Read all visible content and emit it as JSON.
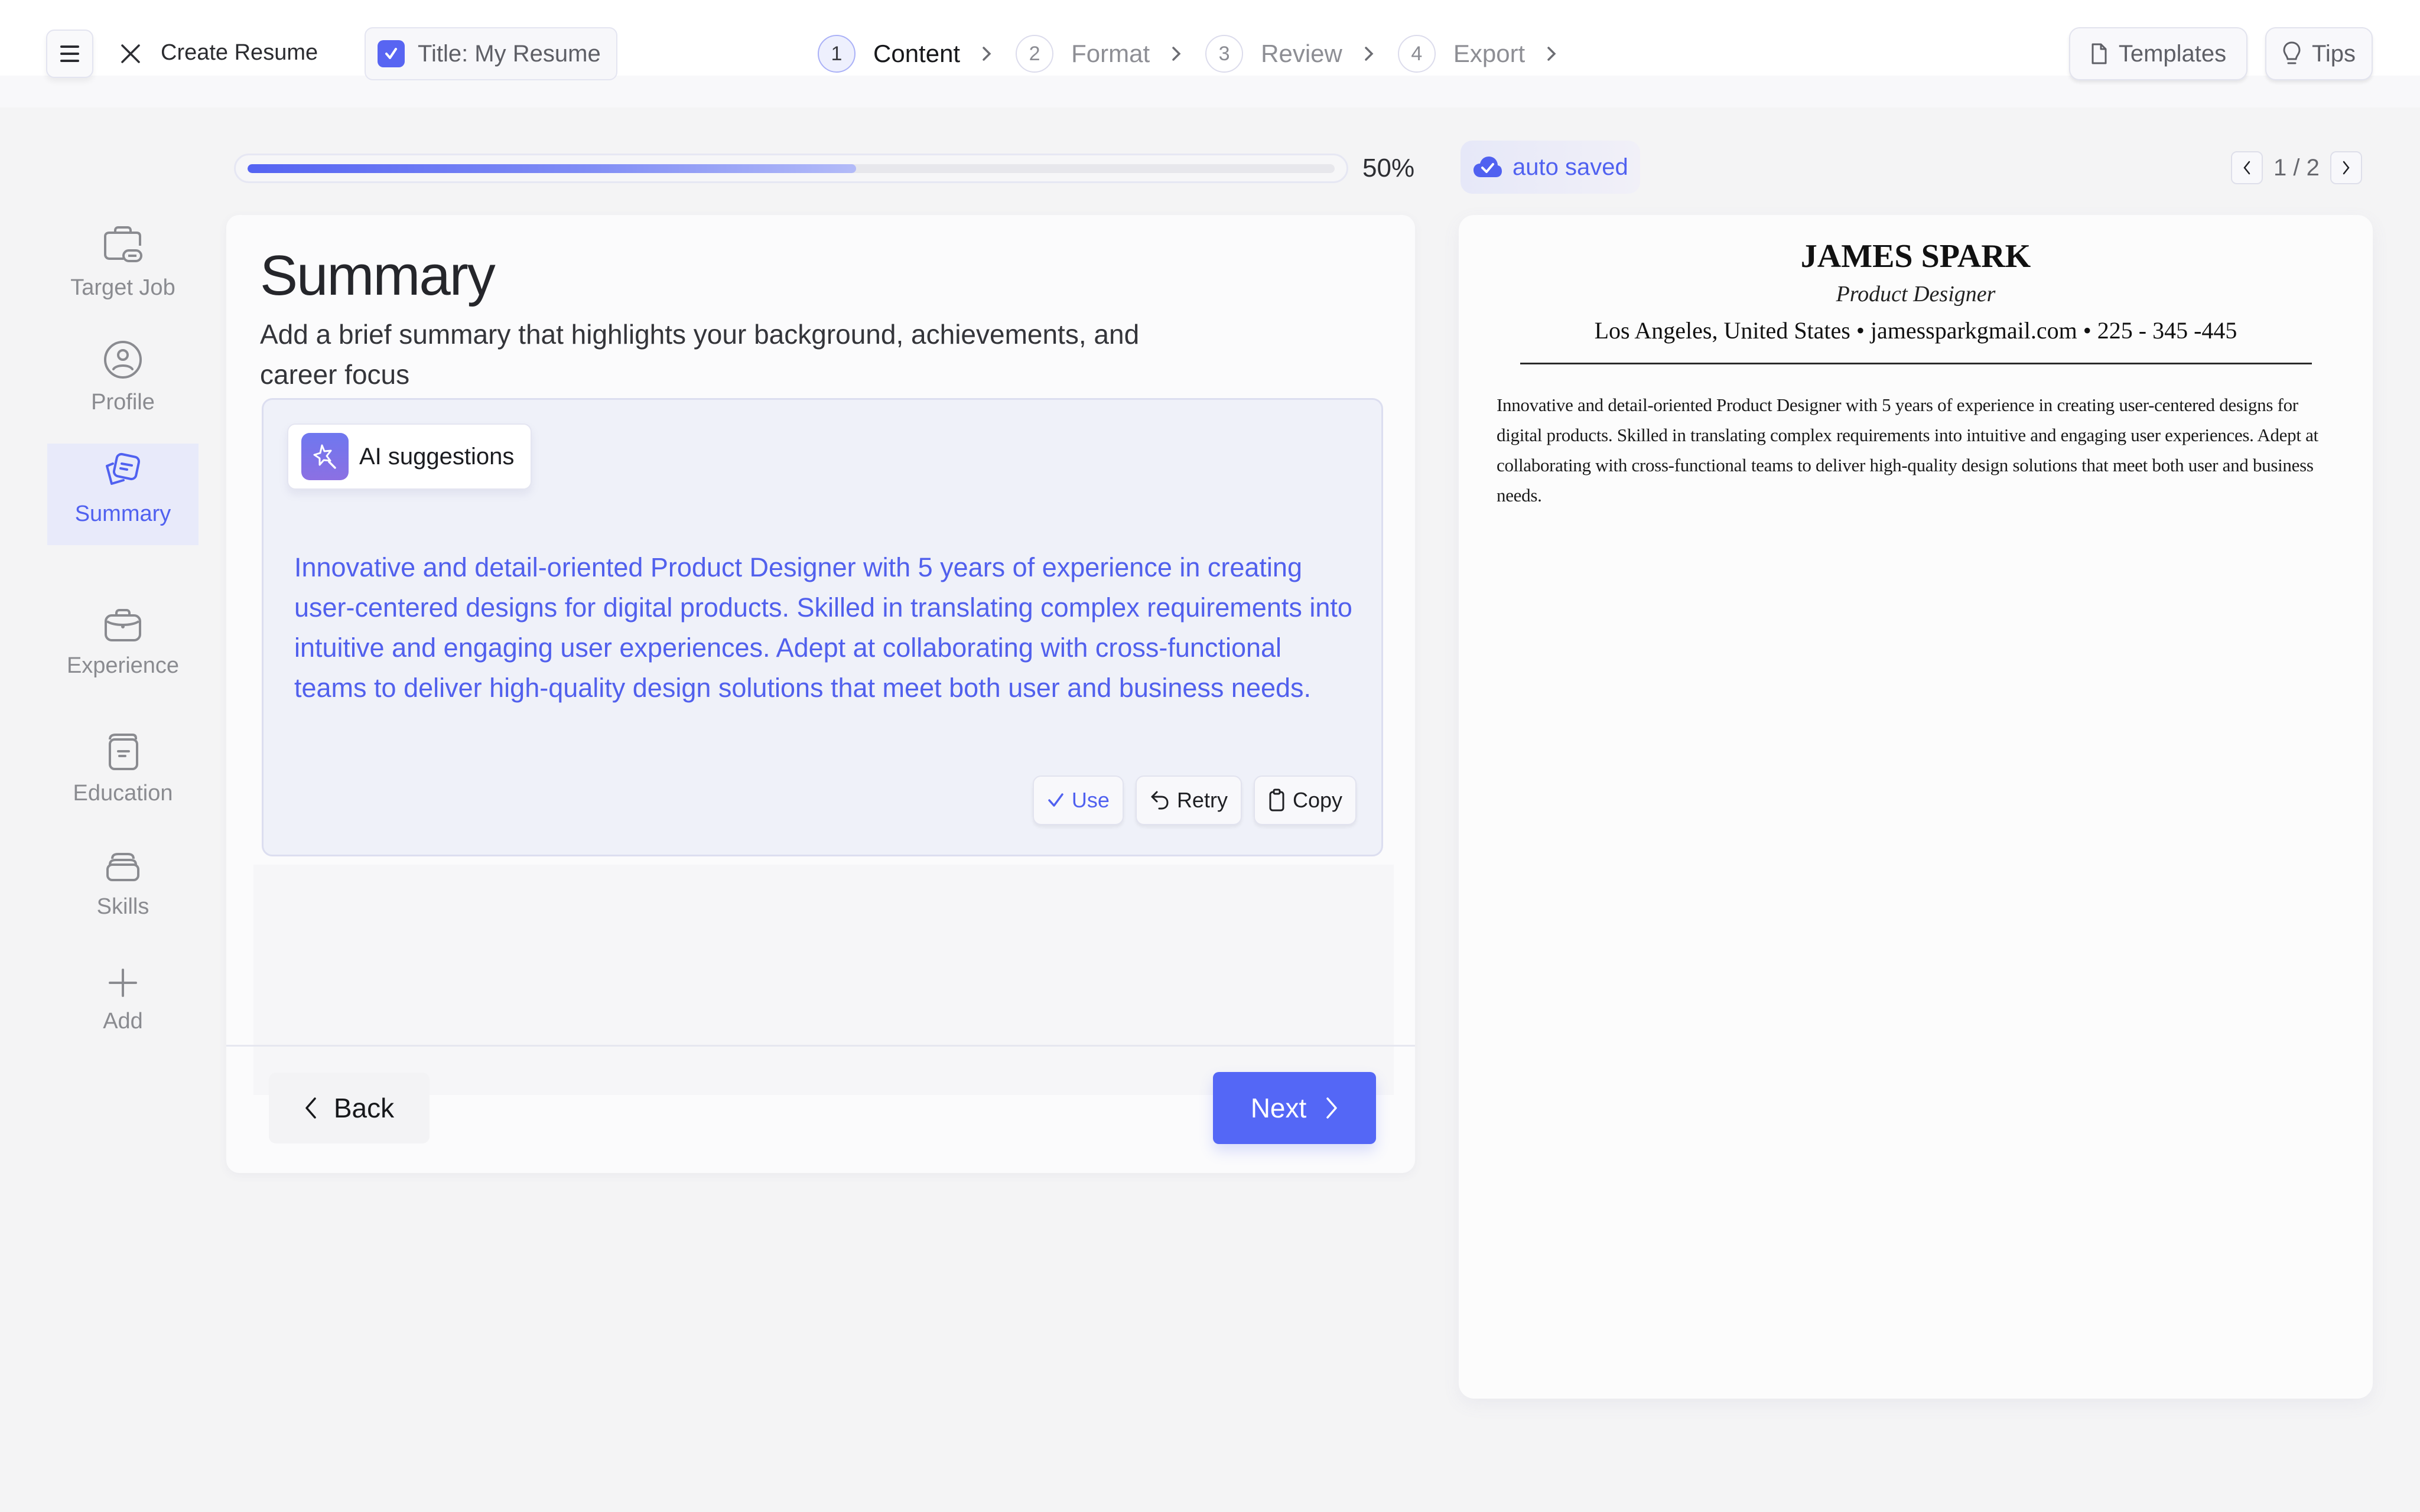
{
  "topbar": {
    "menu_icon": "hamburger-icon",
    "close_icon": "close-icon",
    "create_label": "Create Resume",
    "title_chip": "Title: My Resume",
    "steps": [
      {
        "num": "1",
        "label": "Content",
        "active": true
      },
      {
        "num": "2",
        "label": "Format",
        "active": false
      },
      {
        "num": "3",
        "label": "Review",
        "active": false
      },
      {
        "num": "4",
        "label": "Export",
        "active": false
      }
    ],
    "templates_label": "Templates",
    "tips_label": "Tips"
  },
  "sidebar": {
    "items": [
      {
        "label": "Target Job",
        "icon": "briefcase-link-icon",
        "active": false
      },
      {
        "label": "Profile",
        "icon": "user-circle-icon",
        "active": false
      },
      {
        "label": "Summary",
        "icon": "cards-note-icon",
        "active": true
      },
      {
        "label": "Experience",
        "icon": "briefcase-icon",
        "active": false
      },
      {
        "label": "Education",
        "icon": "book-icon",
        "active": false
      },
      {
        "label": "Skills",
        "icon": "stack-icon",
        "active": false
      },
      {
        "label": "Add",
        "icon": "plus-icon",
        "active": false
      }
    ]
  },
  "progress": {
    "value_percent": 50,
    "label": "50%"
  },
  "editor": {
    "title": "Summary",
    "subtitle": "Add a brief summary that highlights your background, achievements, and career focus",
    "ai": {
      "label": "AI suggestions",
      "text": "Innovative and detail-oriented Product Designer with 5 years of experience in creating user-centered designs for digital products. Skilled in translating complex requirements into intuitive and engaging user experiences. Adept at collaborating with cross-functional teams to deliver high-quality design solutions that meet both user and business needs.",
      "use_label": "Use",
      "retry_label": "Retry",
      "copy_label": "Copy"
    },
    "back_label": "Back",
    "next_label": "Next"
  },
  "preview": {
    "autosave_label": "auto saved",
    "page_indicator": "1 / 2",
    "name": "JAMES SPARK",
    "role": "Product Designer",
    "contact": "Los Angeles, United States • jamessparkgmail.com • 225 - 345 -445",
    "summary": "Innovative and detail-oriented Product Designer with 5 years of experience in creating user-centered designs for digital products. Skilled in translating complex requirements into intuitive and engaging user experiences. Adept at collaborating with cross-functional teams to deliver high-quality design solutions that meet both user and business needs."
  },
  "colors": {
    "accent": "#5467f6",
    "accent_text": "#5061f0",
    "background": "#f4f4f5",
    "ai_box_bg": "#eff1f9"
  }
}
